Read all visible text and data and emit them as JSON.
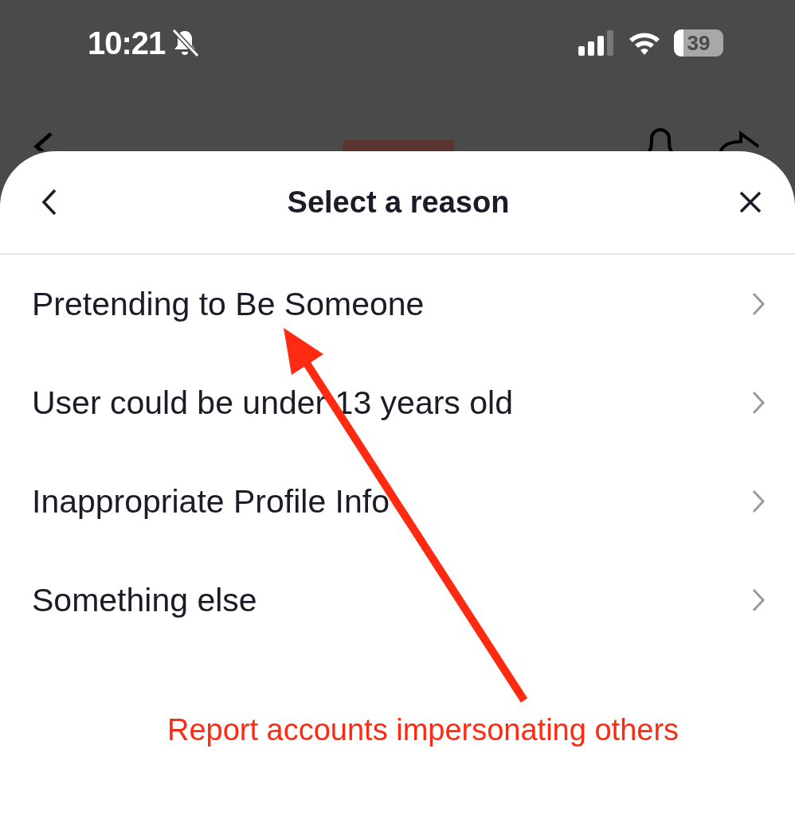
{
  "status_bar": {
    "time": "10:21",
    "battery": "39"
  },
  "sheet": {
    "title": "Select a reason"
  },
  "reasons": [
    {
      "label": "Pretending to Be Someone"
    },
    {
      "label": "User could be under 13 years old"
    },
    {
      "label": "Inappropriate Profile Info"
    },
    {
      "label": "Something else"
    }
  ],
  "annotation": "Report accounts impersonating others"
}
